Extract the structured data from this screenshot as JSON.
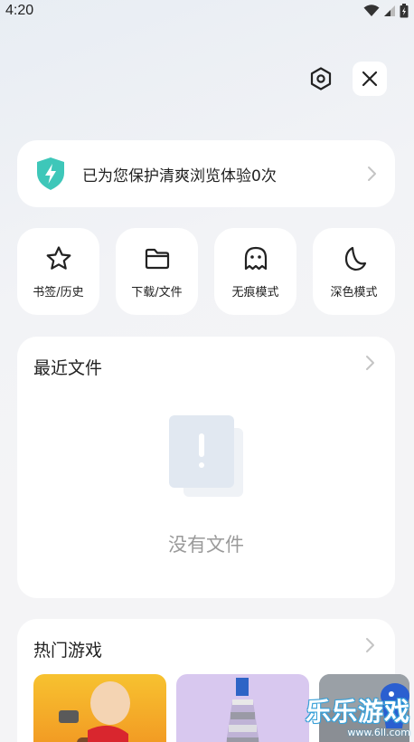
{
  "status": {
    "time": "4:20"
  },
  "protect": {
    "text": "已为您保护清爽浏览体验0次"
  },
  "quick_actions": [
    {
      "label": "书签/历史",
      "icon": "star-icon"
    },
    {
      "label": "下载/文件",
      "icon": "folder-icon"
    },
    {
      "label": "无痕模式",
      "icon": "ghost-icon"
    },
    {
      "label": "深色模式",
      "icon": "moon-icon"
    }
  ],
  "recent_files": {
    "title": "最近文件",
    "empty_text": "没有文件"
  },
  "hot_games": {
    "title": "热门游戏"
  },
  "watermark": {
    "main": "乐乐游戏",
    "sub": "www.6ll.com"
  },
  "colors": {
    "shield": "#3ec7b9",
    "accent": "#3aa0d8"
  }
}
